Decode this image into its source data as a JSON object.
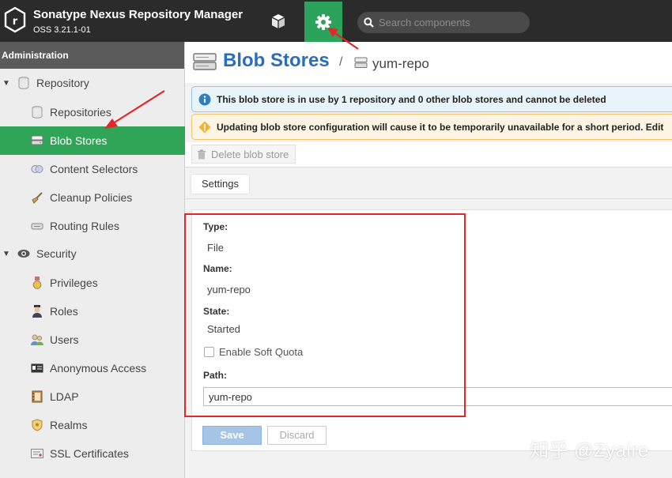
{
  "app": {
    "title": "Sonatype Nexus Repository Manager",
    "version": "OSS 3.21.1-01"
  },
  "header": {
    "search_placeholder": "Search components",
    "accent": "#2ca35a"
  },
  "sidebar": {
    "heading": "Administration",
    "items": [
      {
        "label": "Repository",
        "icon": "database-icon",
        "group": true
      },
      {
        "label": "Repositories",
        "icon": "database-icon"
      },
      {
        "label": "Blob Stores",
        "icon": "blob-store-icon",
        "active": true
      },
      {
        "label": "Content Selectors",
        "icon": "content-selector-icon"
      },
      {
        "label": "Cleanup Policies",
        "icon": "broom-icon"
      },
      {
        "label": "Routing Rules",
        "icon": "routing-icon"
      },
      {
        "label": "Security",
        "icon": "eye-icon",
        "group": true
      },
      {
        "label": "Privileges",
        "icon": "medal-icon"
      },
      {
        "label": "Roles",
        "icon": "role-icon"
      },
      {
        "label": "Users",
        "icon": "users-icon"
      },
      {
        "label": "Anonymous Access",
        "icon": "id-card-icon"
      },
      {
        "label": "LDAP",
        "icon": "address-book-icon"
      },
      {
        "label": "Realms",
        "icon": "shield-icon"
      },
      {
        "label": "SSL Certificates",
        "icon": "certificate-icon"
      }
    ]
  },
  "main": {
    "title": "Blob Stores",
    "breadcrumb_separator": "/",
    "breadcrumb_item": "yum-repo",
    "info_notice": "This blob store is in use by 1 repository and 0 other blob stores and cannot be deleted",
    "warn_notice": "Updating blob store configuration will cause it to be temporarily unavailable for a short period. Edit",
    "delete_label": "Delete blob store",
    "tab_label": "Settings",
    "form": {
      "type_label": "Type:",
      "type_value": "File",
      "name_label": "Name:",
      "name_value": "yum-repo",
      "state_label": "State:",
      "state_value": "Started",
      "soft_quota_label": "Enable Soft Quota",
      "path_label": "Path:",
      "path_value": "yum-repo",
      "save_label": "Save",
      "discard_label": "Discard"
    }
  },
  "watermark": "知乎 @Zyaire"
}
